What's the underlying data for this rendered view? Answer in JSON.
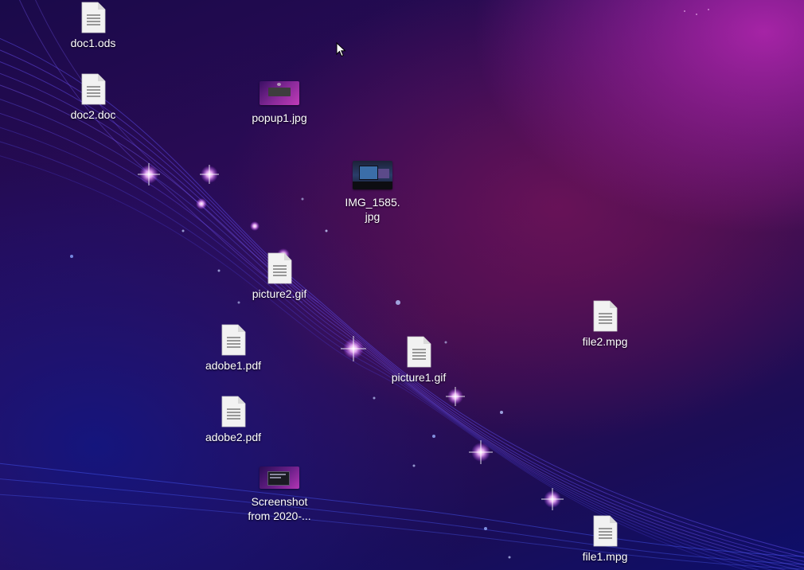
{
  "desktop": {
    "icons": [
      {
        "id": "doc1",
        "label": "doc1.ods",
        "type": "document",
        "icon": "document-icon"
      },
      {
        "id": "doc2",
        "label": "doc2.doc",
        "type": "document",
        "icon": "document-icon"
      },
      {
        "id": "popup1",
        "label": "popup1.jpg",
        "type": "image-thumbnail",
        "icon": "image-thumbnail"
      },
      {
        "id": "img1585",
        "label": "IMG_1585.\njpg",
        "type": "image-thumbnail",
        "icon": "image-thumbnail"
      },
      {
        "id": "picture2",
        "label": "picture2.gif",
        "type": "document",
        "icon": "document-icon"
      },
      {
        "id": "adobe1",
        "label": "adobe1.pdf",
        "type": "document",
        "icon": "document-icon"
      },
      {
        "id": "picture1",
        "label": "picture1.gif",
        "type": "document",
        "icon": "document-icon"
      },
      {
        "id": "file2",
        "label": "file2.mpg",
        "type": "document",
        "icon": "document-icon"
      },
      {
        "id": "adobe2",
        "label": "adobe2.pdf",
        "type": "document",
        "icon": "document-icon"
      },
      {
        "id": "screenshot",
        "label": "Screenshot\nfrom 2020-...",
        "type": "image-thumbnail",
        "icon": "image-thumbnail"
      },
      {
        "id": "file1",
        "label": "file1.mpg",
        "type": "document",
        "icon": "document-icon"
      }
    ]
  },
  "colors": {
    "label_text": "#ffffff",
    "file_icon_fill": "#f2f2f2",
    "file_icon_lines": "#7a7a7a",
    "wallpaper_magenta": "#b8289f",
    "wallpaper_blue": "#1a1f9a"
  }
}
